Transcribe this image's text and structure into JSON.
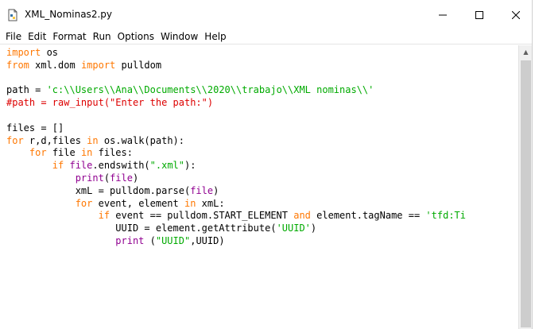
{
  "window": {
    "title": "XML_Nominas2.py",
    "minimize_glyph": "—",
    "maximize_glyph": "☐",
    "close_glyph": "✕",
    "icon": "python-file-icon"
  },
  "menubar": {
    "items": [
      "File",
      "Edit",
      "Format",
      "Run",
      "Options",
      "Window",
      "Help"
    ]
  },
  "colors": {
    "keyword": "#ff7700",
    "builtin": "#900090",
    "string": "#00aa00",
    "comment": "#dd0000"
  },
  "editor": {
    "lines": [
      [
        {
          "t": "kw",
          "v": "import"
        },
        {
          "t": "",
          "v": " os"
        }
      ],
      [
        {
          "t": "kw",
          "v": "from"
        },
        {
          "t": "",
          "v": " xml.dom "
        },
        {
          "t": "kw",
          "v": "import"
        },
        {
          "t": "",
          "v": " pulldom"
        }
      ],
      [],
      [
        {
          "t": "",
          "v": "path = "
        },
        {
          "t": "st",
          "v": "'c:\\\\Users\\\\Ana\\\\Documents\\\\2020\\\\trabajo\\\\XML nominas\\\\'"
        }
      ],
      [
        {
          "t": "cm",
          "v": "#path = raw_input(\"Enter the path:\")"
        }
      ],
      [],
      [
        {
          "t": "",
          "v": "files = []"
        }
      ],
      [
        {
          "t": "kw",
          "v": "for"
        },
        {
          "t": "",
          "v": " r,d,files "
        },
        {
          "t": "kw",
          "v": "in"
        },
        {
          "t": "",
          "v": " os.walk(path):"
        }
      ],
      [
        {
          "t": "",
          "v": "    "
        },
        {
          "t": "kw",
          "v": "for"
        },
        {
          "t": "",
          "v": " file "
        },
        {
          "t": "kw",
          "v": "in"
        },
        {
          "t": "",
          "v": " files:"
        }
      ],
      [
        {
          "t": "",
          "v": "        "
        },
        {
          "t": "kw",
          "v": "if"
        },
        {
          "t": "",
          "v": " "
        },
        {
          "t": "bi",
          "v": "file"
        },
        {
          "t": "",
          "v": ".endswith("
        },
        {
          "t": "st",
          "v": "\".xml\""
        },
        {
          "t": "",
          "v": "):"
        }
      ],
      [
        {
          "t": "",
          "v": "            "
        },
        {
          "t": "bi",
          "v": "print"
        },
        {
          "t": "",
          "v": "("
        },
        {
          "t": "bi",
          "v": "file"
        },
        {
          "t": "",
          "v": ")"
        }
      ],
      [
        {
          "t": "",
          "v": "            xmL = pulldom.parse("
        },
        {
          "t": "bi",
          "v": "file"
        },
        {
          "t": "",
          "v": ")"
        }
      ],
      [
        {
          "t": "",
          "v": "            "
        },
        {
          "t": "kw",
          "v": "for"
        },
        {
          "t": "",
          "v": " event, element "
        },
        {
          "t": "kw",
          "v": "in"
        },
        {
          "t": "",
          "v": " xmL:"
        }
      ],
      [
        {
          "t": "",
          "v": "                "
        },
        {
          "t": "kw",
          "v": "if"
        },
        {
          "t": "",
          "v": " event == pulldom.START_ELEMENT "
        },
        {
          "t": "kw",
          "v": "and"
        },
        {
          "t": "",
          "v": " element.tagName == "
        },
        {
          "t": "st",
          "v": "'tfd:Ti"
        }
      ],
      [
        {
          "t": "",
          "v": "                   UUID = element.getAttribute("
        },
        {
          "t": "st",
          "v": "'UUID'"
        },
        {
          "t": "",
          "v": ")"
        }
      ],
      [
        {
          "t": "",
          "v": "                   "
        },
        {
          "t": "bi",
          "v": "print"
        },
        {
          "t": "",
          "v": " ("
        },
        {
          "t": "st",
          "v": "\"UUID\""
        },
        {
          "t": "",
          "v": ",UUID)"
        }
      ]
    ]
  }
}
